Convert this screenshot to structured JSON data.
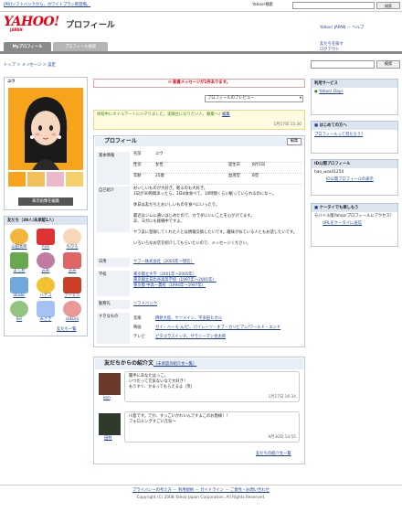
{
  "topbar": {
    "promo": "[PR]ソフトバンクから、ホワイトプラン新登場。",
    "search_label": "Yahoo!検索",
    "search_button": "検索"
  },
  "header": {
    "logo": "YAHOO!",
    "logo_sub": "JAPAN",
    "title": "プロフィール",
    "right_links": "Yahoo! JAPAN － ヘルプ",
    "tabs": [
      "Myプロフィール",
      "プロフィール検索"
    ],
    "tab_right_1": "友だちを探す",
    "tab_right_2": "ログアウト"
  },
  "breadcrumb": "トップ ＞ メッセージ ＞ 設定",
  "find_button": "検索",
  "left": {
    "name": "ユウ",
    "photo_edit": "表示画像を編集",
    "friends_title": "友だち（39人/未承認1人）",
    "friends": [
      {
        "name": "山田太郎"
      },
      {
        "name": "hiro"
      },
      {
        "name": "ちひろ"
      },
      {
        "name": "よしお"
      },
      {
        "name": "yuki"
      },
      {
        "name": "まみ"
      },
      {
        "name": "ababc"
      },
      {
        "name": "ハナコ"
      },
      {
        "name": "アーミン"
      },
      {
        "name": "kei"
      },
      {
        "name": "みさき"
      },
      {
        "name": "sakura"
      }
    ],
    "friends_more": "友だち一覧"
  },
  "main": {
    "new_message": "新着メッセージが1件あります。",
    "preview_select": "プロフィールのプレビュー",
    "notice_text": "休暇中にネイルアートにハマりました。実験台になりたい人、募集〜♪",
    "notice_edit": "編集",
    "notice_date": "1月17日 15:30",
    "profile_title": "プロフィール",
    "edit_label": "編集",
    "basic_title": "基本情報",
    "basic": [
      {
        "label": "名前",
        "value": "ユウ",
        "label2": "",
        "value2": ""
      },
      {
        "label": "性別",
        "value": "女性",
        "label2": "誕生日",
        "value2": "8月1日"
      },
      {
        "label": "年齢",
        "value": "25歳",
        "label2": "血液型",
        "value2": "B型"
      }
    ],
    "intro_title": "自己紹介",
    "intro_lines": [
      "おいしいものが大好き。眠るのも大好き。",
      "1日が30時間あったら、1日4食食べて、10時間くらい眠っていられるのになー。",
      "",
      "休日は友だちとおいしいものを食べにいったり。",
      "",
      "最近はジムに通いはじめたので、カラダにいいことを心がけてます。",
      "あ、ヨガにも挑戦中ですよ。",
      "",
      "ヤフ友に登録してくれた人とは情報交換したいです。趣味が似ている人ともお話したいです。",
      "",
      "いろいろなお店を紹介してもらいたいので、メッセージください。"
    ],
    "work_label": "日用",
    "work_value": "ヤフー株式会社（2005年〜現在）",
    "school_label": "学校",
    "schools": [
      "東京都立大学（2001年〜2005年）",
      "東京都立日比谷高等学校（1997年〜2001年）",
      "東京都 中高一貫校（1994年〜1997年）"
    ],
    "misc_label": "勤務先",
    "misc_value": "ソフトバンク",
    "likes_title": "すきなもの",
    "likes": [
      {
        "label": "音楽",
        "value": "情熱大陸、ケツメイシ、宇多田ヒカル"
      },
      {
        "label": "映画",
        "value": "ガイ・ハーモ ん/ピ、パイレーツ・オブ・カリビアン/ワールド・エンド"
      },
      {
        "label": "テレビ",
        "value": "ピタゴラスイッチ、サラリーマン金太郎"
      }
    ],
    "intro_section_title": "友だちからの紹介文",
    "intro_section_sub": "（未承認の紹介文一覧）",
    "comments": [
      {
        "name": "kon",
        "text1": "聞手にあなたはっこ。",
        "text2": "いつだって元気ないなで大好き！",
        "text3": "もうすぐ、かまってもらえるよ（笑）",
        "date": "1月17日 16:34"
      },
      {
        "name": "田村",
        "text1": "川島です。でか、すっごいかわいんですよこのお勘様！！",
        "text2": "フォロミングすごい元気〜",
        "text3": "",
        "date": "9月30日 14:55"
      }
    ],
    "comments_more": "友だちの紹介文一覧"
  },
  "right": {
    "service_title": "利用サービス",
    "service_item": "Yahoo! Days",
    "start_title": "はじめての方へ",
    "start_link": "プロフィールって何だろう?",
    "id_title": "ID公開プロフィール",
    "id_value": "hao_wsxd1254",
    "id_link": "ID公開プロフィールの表示",
    "mobile_title": "ケータイでも楽しもう",
    "mobile_text": "モバイル版Yahoo!プロフィールにアクセス！",
    "mobile_link": "URLをケータイに送信"
  },
  "footer": {
    "links": "プライバシーの考え方 － 利用規約 － ガイドライン － ご意見・お問い合わせ",
    "copyright": "Copyright (C) 2008 Yahoo Japan Corporation. All Rights Reserved."
  },
  "colors": {
    "accent": "#1a3ea8",
    "brand": "#e60012",
    "boxhead": "#dde6f0",
    "notice": "#fffbe0"
  }
}
